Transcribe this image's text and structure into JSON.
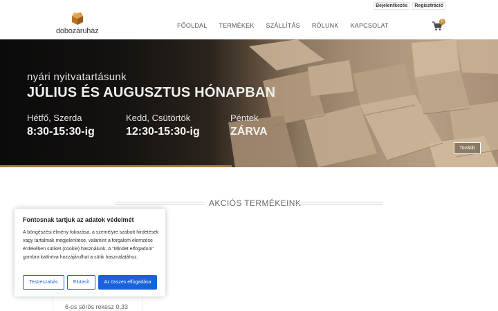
{
  "top_links": {
    "login": "Bejelentkezés",
    "register": "Regisztráció"
  },
  "logo": {
    "text": "dobozáruház"
  },
  "nav": [
    "FŐOLDAL",
    "TERMÉKEK",
    "SZÁLLÍTÁS",
    "RÓLUNK",
    "KAPCSOLAT"
  ],
  "cart": {
    "count": "0",
    "icon": "cart-icon"
  },
  "hero": {
    "subtitle": "nyári nyitvatartásunk",
    "title": "JÚLIUS ÉS AUGUSZTUS HÓNAPBAN",
    "schedule": [
      {
        "day": "Hétfő, Szerda",
        "hours": "8:30-15:30-ig"
      },
      {
        "day": "Kedd, Csütörtök",
        "hours": "12:30-15:30-ig"
      },
      {
        "day": "Péntek",
        "hours": "ZÁRVA"
      }
    ],
    "button": "Tovább"
  },
  "section": {
    "title": "AKCIÓS TERMÉKEINK"
  },
  "product": {
    "name": "6-os sörös rekesz 0,33"
  },
  "cookie": {
    "title": "Fontosnak tartjuk az adatok védelmét",
    "text": "A böngészési élmény fokozása, a személyre szabott hirdetések vagy tartalmak megjelenítése, valamint a forgalom elemzése érdekében sütiket (cookie) használunk. A \"Mindet elfogadom\" gombra kattintva hozzájárulhat a sütik használatához.",
    "btn_customize": "Testreszabás",
    "btn_reject": "Elutasít",
    "btn_accept": "Az összes elfogadása"
  },
  "colors": {
    "accent": "#c7913f",
    "cookie_blue": "#1863dc",
    "hero_dark": "#0b0b0b"
  }
}
